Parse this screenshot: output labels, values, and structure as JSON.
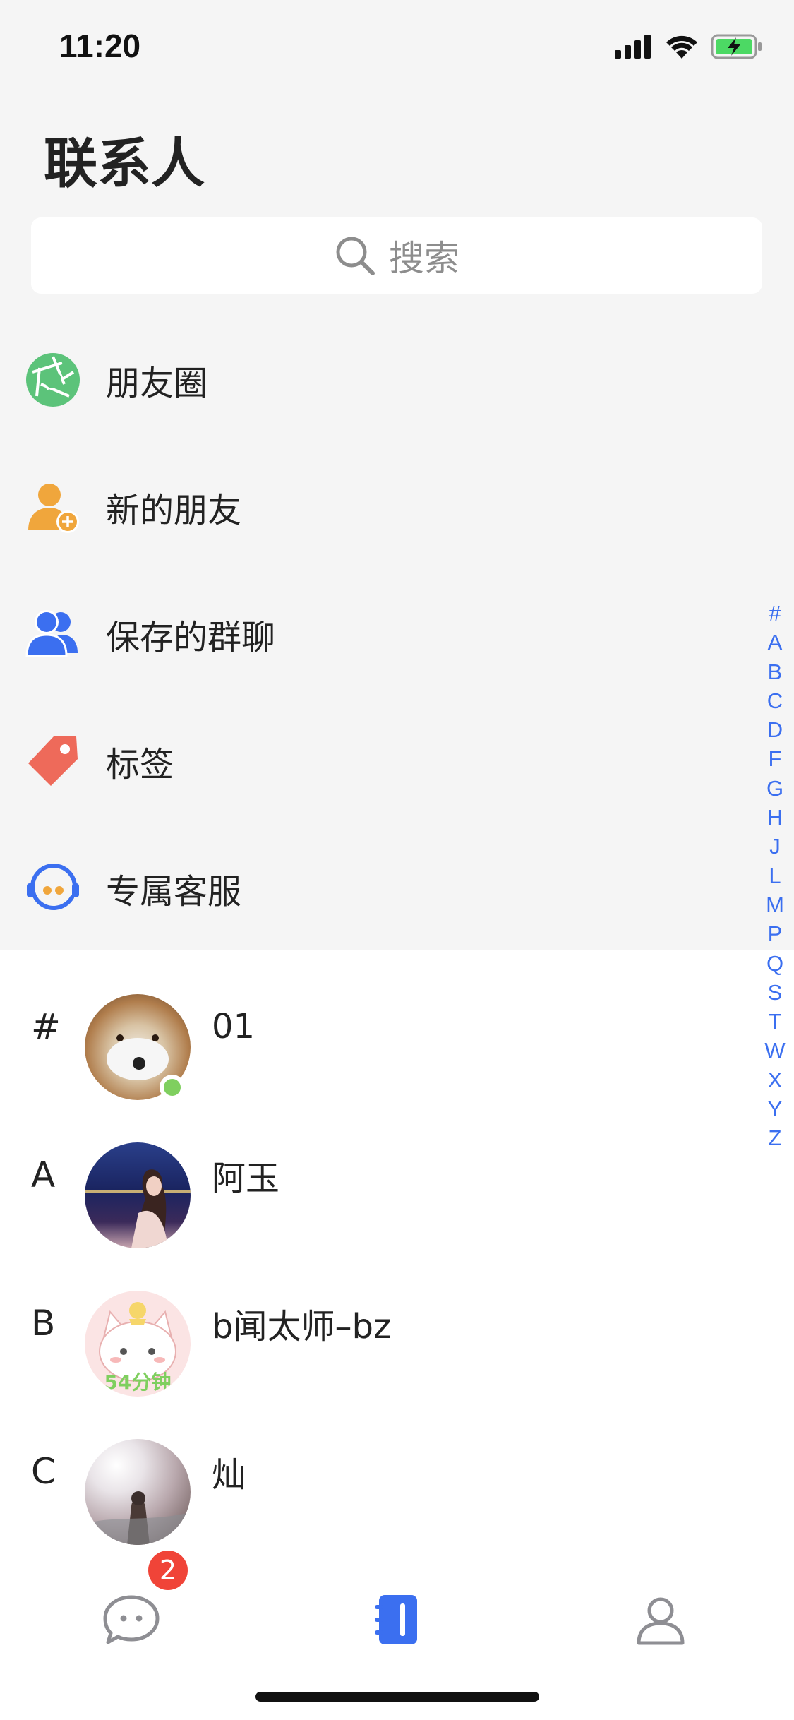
{
  "status_bar": {
    "time": "11:20",
    "icons": [
      "signal-icon",
      "wifi-icon",
      "battery-charging-icon"
    ]
  },
  "header": {
    "title": "联系人"
  },
  "search": {
    "placeholder": "搜索",
    "icon": "search-icon"
  },
  "menu": [
    {
      "label": "朋友圈",
      "icon": "moments-aperture-icon",
      "color": "#5cc37a"
    },
    {
      "label": "新的朋友",
      "icon": "add-friend-icon",
      "color": "#f0a63c"
    },
    {
      "label": "保存的群聊",
      "icon": "group-icon",
      "color": "#3b6ff0"
    },
    {
      "label": "标签",
      "icon": "tag-icon",
      "color": "#ee6a5a"
    },
    {
      "label": "专属客服",
      "icon": "customer-service-icon",
      "color": "#3b6ff0"
    }
  ],
  "contacts": [
    {
      "letter": "#",
      "name": "01",
      "avatar": "shiba-dog-avatar",
      "online": true
    },
    {
      "letter": "A",
      "name": "阿玉",
      "avatar": "girl-night-photo-avatar"
    },
    {
      "letter": "B",
      "name": "b闻太师–bz",
      "avatar": "cartoon-cat-avatar",
      "avatar_caption": "54分钟"
    },
    {
      "letter": "C",
      "name": "灿",
      "avatar": "sunlight-photo-avatar"
    }
  ],
  "index_letters": [
    "#",
    "A",
    "B",
    "C",
    "D",
    "F",
    "G",
    "H",
    "J",
    "L",
    "M",
    "P",
    "Q",
    "S",
    "T",
    "W",
    "X",
    "Y",
    "Z"
  ],
  "tabbar": {
    "tabs": [
      {
        "name": "chats",
        "icon": "chat-bubble-icon",
        "badge": "2"
      },
      {
        "name": "contacts",
        "icon": "address-book-icon",
        "active": true
      },
      {
        "name": "me",
        "icon": "person-icon"
      }
    ]
  },
  "colors": {
    "accent": "#3b6ff0",
    "badge": "#f04438",
    "online": "#7fcf5f",
    "background": "#f5f5f5"
  }
}
